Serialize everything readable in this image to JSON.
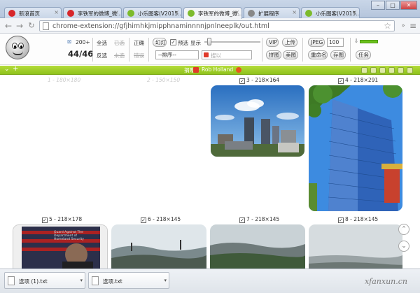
{
  "tabs": [
    {
      "label": "新浪首页",
      "active": false,
      "color": "#d7262a"
    },
    {
      "label": "李铁军的微博_微...",
      "active": false,
      "color": "#d7262a"
    },
    {
      "label": "小乐图客(V2015...",
      "active": false,
      "color": "#7dbb2c"
    },
    {
      "label": "李铁军的微博_微...",
      "active": true,
      "color": "#7dbb2c"
    },
    {
      "label": "扩展程序",
      "active": false,
      "color": "#888888"
    },
    {
      "label": "小乐图客(V2015...",
      "active": false,
      "color": "#7dbb2c"
    }
  ],
  "window": {
    "minimize": "–",
    "maximize": "□",
    "close": "✕"
  },
  "address": {
    "url": "chrome-extension://gfjhimhkjmipphnaminnnnjpnlneeplk/out.html"
  },
  "toolbar": {
    "size_label": "200+",
    "count": "44/46",
    "select_all": "全选",
    "selected": "已选",
    "invert": "反选",
    "unselected": "未选",
    "correct": "正确",
    "wrong": "错误",
    "slideshow": "幻灯",
    "preview": "预选",
    "show": "显示",
    "sort": "--排序--",
    "search_placeholder": "搜以",
    "vip": "VIP",
    "upload": "上传",
    "stitch": "拼图",
    "beautify": "美图",
    "format": "JPEG",
    "quality": "100",
    "rename": "重命名",
    "save": "存图",
    "tasks": "任务"
  },
  "greenbar": {
    "credit_label": "捐赠者",
    "author": "Rob Holland"
  },
  "images": [
    {
      "index": 1,
      "size": "180×180",
      "caption": "1 - 180×180",
      "checked": false,
      "faded": true
    },
    {
      "index": 2,
      "size": "150×150",
      "caption": "2 - 150×150",
      "checked": false,
      "faded": true
    },
    {
      "index": 3,
      "size": "218×164",
      "caption": "3 - 218×164",
      "checked": true,
      "faded": false
    },
    {
      "index": 4,
      "size": "218×291",
      "caption": "4 - 218×291",
      "checked": true,
      "faded": false
    },
    {
      "index": 5,
      "size": "218×178",
      "caption": "5 - 218×178",
      "checked": true,
      "faded": false
    },
    {
      "index": 6,
      "size": "218×145",
      "caption": "6 - 218×145",
      "checked": true,
      "faded": false
    },
    {
      "index": 7,
      "size": "218×145",
      "caption": "7 - 218×145",
      "checked": true,
      "faded": false
    },
    {
      "index": 8,
      "size": "218×145",
      "caption": "8 - 218×145",
      "checked": true,
      "faded": false
    }
  ],
  "thumb5_text": "Guard Against The\nDepartment of\nHomeland Security",
  "downloads": [
    {
      "filename": "选项 (1).txt"
    },
    {
      "filename": "选项.txt"
    }
  ],
  "watermark": "xfanxun.cn"
}
